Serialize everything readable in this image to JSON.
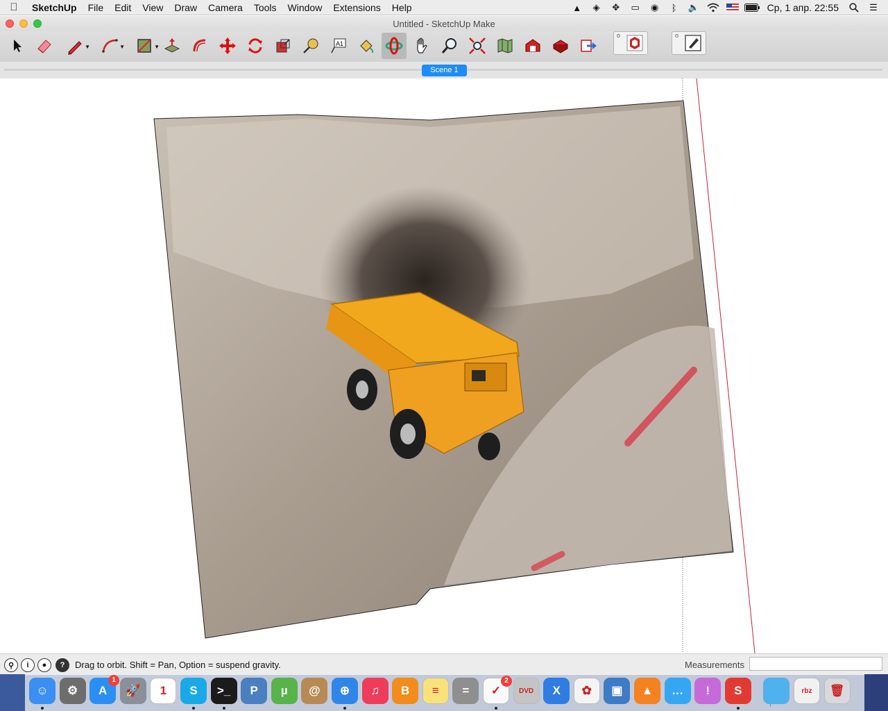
{
  "menubar": {
    "app_name": "SketchUp",
    "items": [
      "File",
      "Edit",
      "View",
      "Draw",
      "Camera",
      "Tools",
      "Window",
      "Extensions",
      "Help"
    ],
    "clock": "Ср, 1 апр.  22:55"
  },
  "window": {
    "title": "Untitled - SketchUp Make"
  },
  "toolbar": {
    "tools": [
      "select-tool",
      "eraser-tool",
      "line-tool",
      "arc-tool",
      "shape-tool",
      "push-pull-tool",
      "offset-tool",
      "move-tool",
      "rotate-tool",
      "scale-tool",
      "tape-measure-tool",
      "text-tool",
      "paint-bucket-tool",
      "orbit-tool",
      "pan-tool",
      "zoom-tool",
      "zoom-extents-tool",
      "add-location-tool",
      "3d-warehouse-tool",
      "share-model-tool",
      "extension-warehouse-tool",
      "layout-send-tool"
    ],
    "active_tool": "orbit-tool"
  },
  "scenes": {
    "tabs": [
      "Scene 1"
    ]
  },
  "statusbar": {
    "hint": "Drag to orbit. Shift = Pan, Option = suspend gravity.",
    "measurements_label": "Measurements",
    "measurements_value": ""
  },
  "dock": {
    "apps": [
      {
        "name": "Finder",
        "label": "☺",
        "color": "#3b8ff0"
      },
      {
        "name": "System Preferences",
        "label": "⚙",
        "color": "#6d6d6d"
      },
      {
        "name": "App Store",
        "label": "A",
        "color": "#2b8ff2",
        "badge": "1"
      },
      {
        "name": "Launchpad",
        "label": "🚀",
        "color": "#8a8f9a"
      },
      {
        "name": "Calendar",
        "label": "1",
        "color": "#ffffff"
      },
      {
        "name": "Skype",
        "label": "S",
        "color": "#1aa9e8"
      },
      {
        "name": "Terminal",
        "label": ">_",
        "color": "#1b1b1b"
      },
      {
        "name": "Preview",
        "label": "P",
        "color": "#4a7fc0"
      },
      {
        "name": "uTorrent",
        "label": "µ",
        "color": "#57b34a"
      },
      {
        "name": "Contacts",
        "label": "@",
        "color": "#b78a55"
      },
      {
        "name": "Safari",
        "label": "⊕",
        "color": "#2f86e8"
      },
      {
        "name": "iTunes",
        "label": "♫",
        "color": "#ee3d5a"
      },
      {
        "name": "iBooks",
        "label": "B",
        "color": "#f28c1d"
      },
      {
        "name": "Notes",
        "label": "≡",
        "color": "#f8e27a"
      },
      {
        "name": "Calculator",
        "label": "=",
        "color": "#8f8f8f"
      },
      {
        "name": "Reminders",
        "label": "✓",
        "color": "#fafafa",
        "badge": "2"
      },
      {
        "name": "DVD Player",
        "label": "DVD",
        "color": "#c4c4c4"
      },
      {
        "name": "Xcode",
        "label": "X",
        "color": "#2f7de0"
      },
      {
        "name": "Photos",
        "label": "✿",
        "color": "#f4f4f4"
      },
      {
        "name": "Image Capture",
        "label": "▣",
        "color": "#3d7bc4"
      },
      {
        "name": "VLC",
        "label": "▲",
        "color": "#f58220"
      },
      {
        "name": "Messages",
        "label": "…",
        "color": "#35a7f2"
      },
      {
        "name": "Feedback",
        "label": "!",
        "color": "#c56ad8"
      },
      {
        "name": "SketchUp",
        "label": "S",
        "color": "#e23a32"
      },
      {
        "name": "Downloads Folder",
        "label": "",
        "color": "#4fb1ee"
      },
      {
        "name": "Archive",
        "label": "rbz",
        "color": "#f1f1f1"
      },
      {
        "name": "Trash",
        "label": "🗑",
        "color": "#d7d9dc"
      }
    ]
  }
}
